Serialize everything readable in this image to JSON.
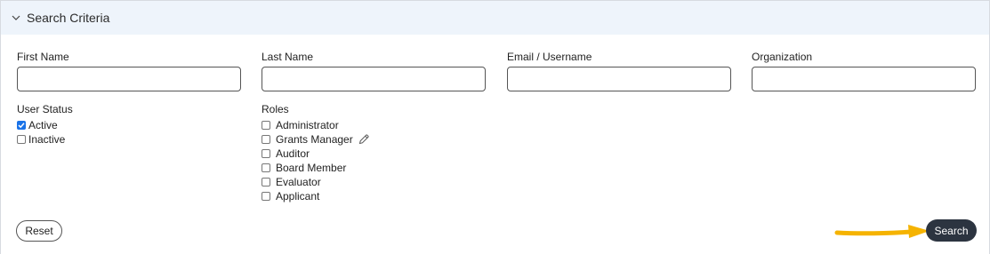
{
  "section": {
    "title": "Search Criteria",
    "icon": "chevron-down-icon"
  },
  "fields": [
    {
      "label": "First Name",
      "value": ""
    },
    {
      "label": "Last Name",
      "value": ""
    },
    {
      "label": "Email / Username",
      "value": ""
    },
    {
      "label": "Organization",
      "value": ""
    }
  ],
  "user_status": {
    "label": "User Status",
    "options": [
      {
        "label": "Active",
        "checked": true
      },
      {
        "label": "Inactive",
        "checked": false
      }
    ]
  },
  "roles": {
    "label": "Roles",
    "options": [
      {
        "label": "Administrator",
        "checked": false
      },
      {
        "label": "Grants Manager",
        "checked": false,
        "icon": "pencil-icon"
      },
      {
        "label": "Auditor",
        "checked": false
      },
      {
        "label": "Board Member",
        "checked": false
      },
      {
        "label": "Evaluator",
        "checked": false
      },
      {
        "label": "Applicant",
        "checked": false
      }
    ]
  },
  "actions": {
    "reset_label": "Reset",
    "search_label": "Search"
  },
  "colors": {
    "header_bg": "#eef4fb",
    "search_bg": "#2c3440",
    "checked": "#1a73e8",
    "arrow": "#f5b301"
  }
}
